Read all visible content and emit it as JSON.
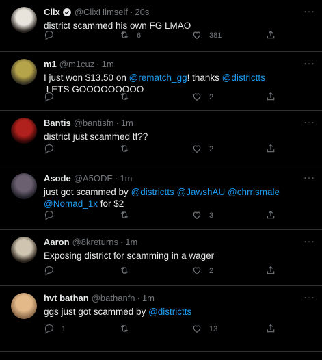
{
  "tweets": [
    {
      "name": "Clix",
      "handle": "@ClixHimself",
      "time": "20s",
      "verified": true,
      "segments": [
        {
          "t": "district scammed his own FG LMAO",
          "m": false
        }
      ],
      "reply_count": "",
      "retweet_count": "6",
      "like_count": "381",
      "avatar_colors": [
        "#e8e4dc",
        "#2a2420"
      ]
    },
    {
      "name": "m1",
      "handle": "@m1cuz",
      "time": "1m",
      "verified": false,
      "segments": [
        {
          "t": "I just won $13.50 on ",
          "m": false
        },
        {
          "t": "@rematch_gg",
          "m": true
        },
        {
          "t": "! thanks ",
          "m": false
        },
        {
          "t": "@districtts",
          "m": true
        },
        {
          "t": "\n LETS GOOOOOOOOO",
          "m": false
        }
      ],
      "reply_count": "",
      "retweet_count": "",
      "like_count": "2",
      "avatar_colors": [
        "#b6a44a",
        "#3a3524"
      ]
    },
    {
      "name": "Bantis",
      "handle": "@bantisfn",
      "time": "1m",
      "verified": false,
      "segments": [
        {
          "t": "district just scammed tf??",
          "m": false
        }
      ],
      "reply_count": "",
      "retweet_count": "",
      "like_count": "2",
      "avatar_colors": [
        "#b0201c",
        "#2a0606"
      ]
    },
    {
      "name": "Asode",
      "handle": "@A5ODE",
      "time": "1m",
      "verified": false,
      "segments": [
        {
          "t": "just got scammed by ",
          "m": false
        },
        {
          "t": "@districtts",
          "m": true
        },
        {
          "t": " ",
          "m": false
        },
        {
          "t": "@JawshAU",
          "m": true
        },
        {
          "t": " ",
          "m": false
        },
        {
          "t": "@chrrismale",
          "m": true
        },
        {
          "t": " ",
          "m": false
        },
        {
          "t": "@Nomad_1x",
          "m": true
        },
        {
          "t": " for $2",
          "m": false
        }
      ],
      "reply_count": "",
      "retweet_count": "",
      "like_count": "3",
      "avatar_colors": [
        "#6a6070",
        "#222028"
      ]
    },
    {
      "name": "Aaron",
      "handle": "@8kreturns",
      "time": "1m",
      "verified": false,
      "segments": [
        {
          "t": "Exposing district for scamming in a wager",
          "m": false
        }
      ],
      "reply_count": "",
      "retweet_count": "",
      "like_count": "2",
      "avatar_colors": [
        "#cfc4b0",
        "#2b241c"
      ]
    },
    {
      "name": "hvt bathan",
      "handle": "@bathanfn",
      "time": "1m",
      "verified": false,
      "segments": [
        {
          "t": "ggs just got scammed by ",
          "m": false
        },
        {
          "t": "@districtts",
          "m": true
        }
      ],
      "reply_count": "1",
      "retweet_count": "",
      "like_count": "13",
      "avatar_colors": [
        "#e3b98a",
        "#8d6b4a"
      ]
    }
  ],
  "colors": {
    "accent": "#1d9bf0",
    "muted": "#71767b",
    "text": "#e7e9ea",
    "divider": "#2f3336",
    "background": "#000000"
  }
}
